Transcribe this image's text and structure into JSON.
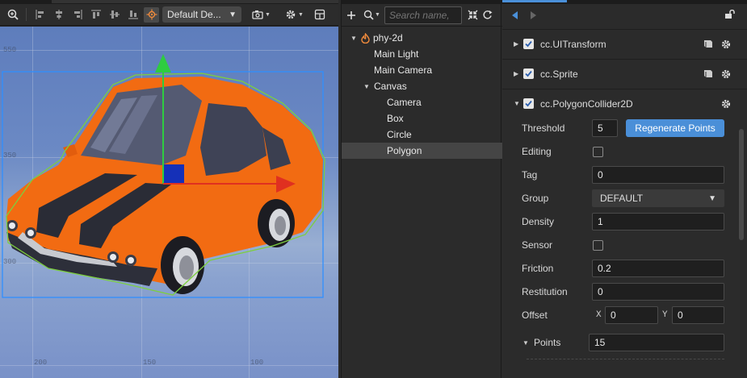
{
  "toolbar": {
    "resolution_label": "Default De...",
    "icons": [
      "zoom-fit-icon",
      "align-left-icon",
      "align-center-icon",
      "align-right-icon",
      "align-top-icon",
      "align-middle-icon",
      "align-bottom-icon",
      "gizmo-icon",
      "camera-icon",
      "gear-icon",
      "layout-icon"
    ]
  },
  "scene": {
    "grid_labels": [
      "550",
      "350",
      "300",
      "200",
      "150",
      "100"
    ]
  },
  "hierarchy": {
    "search_placeholder": "Search name,",
    "items": [
      {
        "label": "phy-2d",
        "depth": 0,
        "expanded": true,
        "root": true
      },
      {
        "label": "Main Light",
        "depth": 1
      },
      {
        "label": "Main Camera",
        "depth": 1
      },
      {
        "label": "Canvas",
        "depth": 1,
        "expanded": true
      },
      {
        "label": "Camera",
        "depth": 2
      },
      {
        "label": "Box",
        "depth": 2
      },
      {
        "label": "Circle",
        "depth": 2
      },
      {
        "label": "Polygon",
        "depth": 2,
        "selected": true
      }
    ]
  },
  "inspector": {
    "components": [
      {
        "name": "cc.UITransform",
        "enabled": true,
        "expanded": false
      },
      {
        "name": "cc.Sprite",
        "enabled": true,
        "expanded": false
      },
      {
        "name": "cc.PolygonCollider2D",
        "enabled": true,
        "expanded": true
      }
    ],
    "props": {
      "threshold_label": "Threshold",
      "threshold_value": "5",
      "regenerate_label": "Regenerate Points",
      "editing_label": "Editing",
      "editing_checked": false,
      "tag_label": "Tag",
      "tag_value": "0",
      "group_label": "Group",
      "group_value": "DEFAULT",
      "density_label": "Density",
      "density_value": "1",
      "sensor_label": "Sensor",
      "sensor_checked": false,
      "friction_label": "Friction",
      "friction_value": "0.2",
      "restitution_label": "Restitution",
      "restitution_value": "0",
      "offset_label": "Offset",
      "offset_x_label": "X",
      "offset_x_value": "0",
      "offset_y_label": "Y",
      "offset_y_value": "0",
      "points_label": "Points",
      "points_value": "15"
    }
  },
  "colors": {
    "accent": "#4a8fd8",
    "car_body": "#f26b12",
    "gizmo_green": "#2ecc40",
    "gizmo_red": "#e03020",
    "selection_box": "#2f8fff"
  }
}
